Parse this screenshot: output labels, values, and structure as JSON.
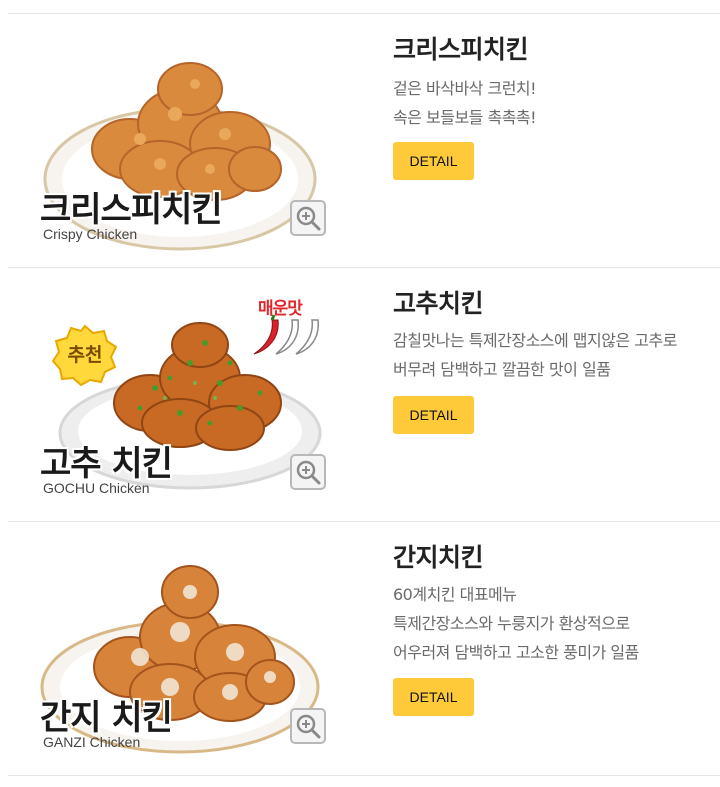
{
  "menu": {
    "items": [
      {
        "image_title": "크리스피치킨",
        "image_subtitle": "Crispy Chicken",
        "title": "크리스피치킨",
        "desc": [
          "겉은 바삭바삭 크런치!",
          "속은 보들보들 촉촉촉!"
        ],
        "button_label": "DETAIL"
      },
      {
        "image_title": "고추 치킨",
        "image_subtitle": "GOCHU Chicken",
        "badge_hot": "매운맛",
        "badge_recommend": "추천",
        "title": "고추치킨",
        "desc": [
          "감칠맛나는 특제간장소스에 맵지않은 고추로",
          "버무려 담백하고 깔끔한 맛이 일품"
        ],
        "button_label": "DETAIL"
      },
      {
        "image_title": "간지 치킨",
        "image_subtitle": "GANZI Chicken",
        "title": "간지치킨",
        "desc": [
          "60계치킨 대표메뉴",
          "특제간장소스와 누룽지가 환상적으로",
          "어우러져 담백하고 고소한 풍미가 일품"
        ],
        "button_label": "DETAIL"
      }
    ]
  },
  "icons": {
    "zoom": "zoom-in-icon",
    "chili": "chili-pepper-icon"
  },
  "colors": {
    "button_bg": "#ffca3a",
    "hot_badge": "#e3262d",
    "divider": "#e6e6e6"
  }
}
